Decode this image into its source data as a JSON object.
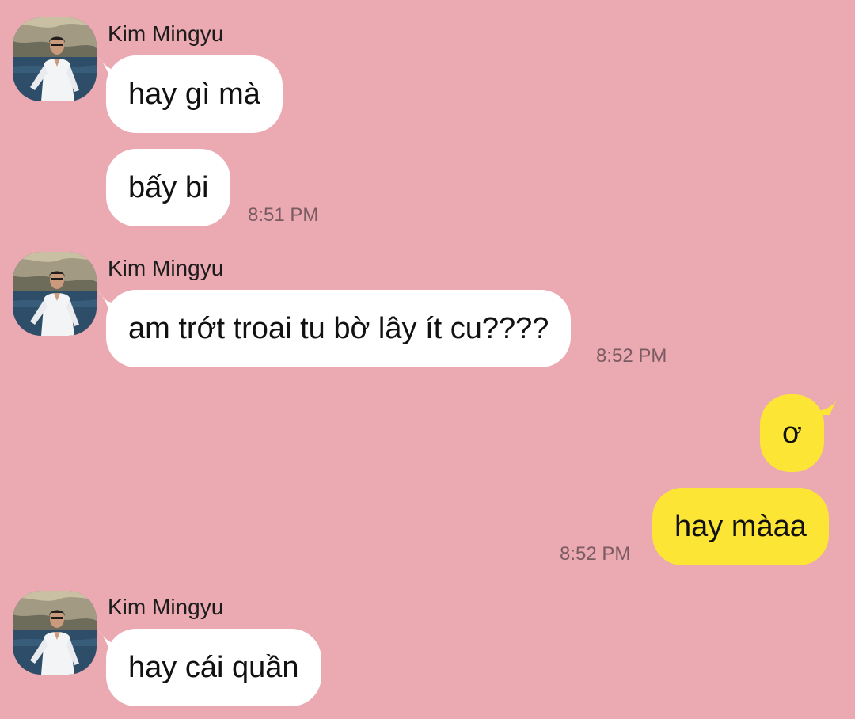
{
  "messages": [
    {
      "sender": "Kim Mingyu",
      "avatar_icon": "contact-avatar-photo",
      "bubbles": [
        "hay gì mà",
        "bấy bi"
      ],
      "time": "8:51 PM"
    },
    {
      "sender": "Kim Mingyu",
      "avatar_icon": "contact-avatar-photo",
      "bubbles": [
        "am trớt troai tu bờ lây ít cu????"
      ],
      "time": "8:52 PM"
    },
    {
      "sender": "me",
      "bubbles": [
        "ơ",
        "hay màaa"
      ],
      "time": "8:52 PM"
    },
    {
      "sender": "Kim Mingyu",
      "avatar_icon": "contact-avatar-photo",
      "bubbles": [
        "hay cái quần"
      ]
    }
  ],
  "colors": {
    "background": "#eba9b2",
    "incoming_bubble": "#ffffff",
    "outgoing_bubble": "#fde535",
    "timestamp": "#7a5b61"
  }
}
